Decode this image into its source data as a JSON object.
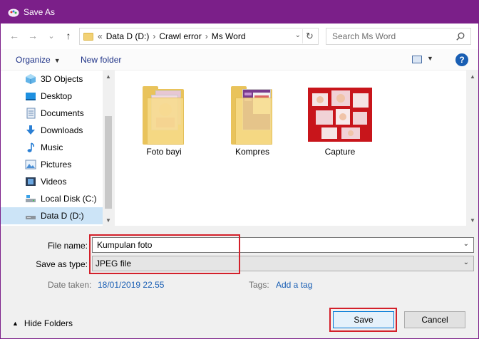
{
  "window": {
    "title": "Save As"
  },
  "nav": {
    "back_label": "←",
    "forward_label": "→",
    "recent_label": "⌄",
    "up_label": "↑",
    "breadcrumb": [
      "«",
      "Data D (D:)",
      "Crawl error",
      "Ms Word"
    ],
    "breadcrumb_sep": "›",
    "search_placeholder": "Search Ms Word"
  },
  "toolbar": {
    "organize_label": "Organize",
    "new_folder_label": "New folder",
    "help_label": "?"
  },
  "sidebar": {
    "items": [
      {
        "label": "3D Objects",
        "icon": "3d-objects-icon"
      },
      {
        "label": "Desktop",
        "icon": "desktop-icon"
      },
      {
        "label": "Documents",
        "icon": "documents-icon"
      },
      {
        "label": "Downloads",
        "icon": "downloads-icon"
      },
      {
        "label": "Music",
        "icon": "music-icon"
      },
      {
        "label": "Pictures",
        "icon": "pictures-icon"
      },
      {
        "label": "Videos",
        "icon": "videos-icon"
      },
      {
        "label": "Local Disk (C:)",
        "icon": "local-disk-icon"
      },
      {
        "label": "Data D (D:)",
        "icon": "drive-icon",
        "selected": true
      }
    ]
  },
  "files": [
    {
      "name": "Foto bayi",
      "kind": "folder"
    },
    {
      "name": "Kompres",
      "kind": "folder"
    },
    {
      "name": "Capture",
      "kind": "image"
    }
  ],
  "form": {
    "file_name_label": "File name:",
    "file_name_value": "Kumpulan foto",
    "save_as_type_label": "Save as type:",
    "save_as_type_value": "JPEG file",
    "date_taken_label": "Date taken:",
    "date_taken_value": "18/01/2019 22.55",
    "tags_label": "Tags:",
    "tags_value": "Add a tag"
  },
  "footer": {
    "hide_folders_label": "Hide Folders",
    "save_label": "Save",
    "cancel_label": "Cancel"
  },
  "colors": {
    "titlebar": "#7b1f89",
    "highlight": "#d3202a",
    "link": "#1a5fb4"
  }
}
